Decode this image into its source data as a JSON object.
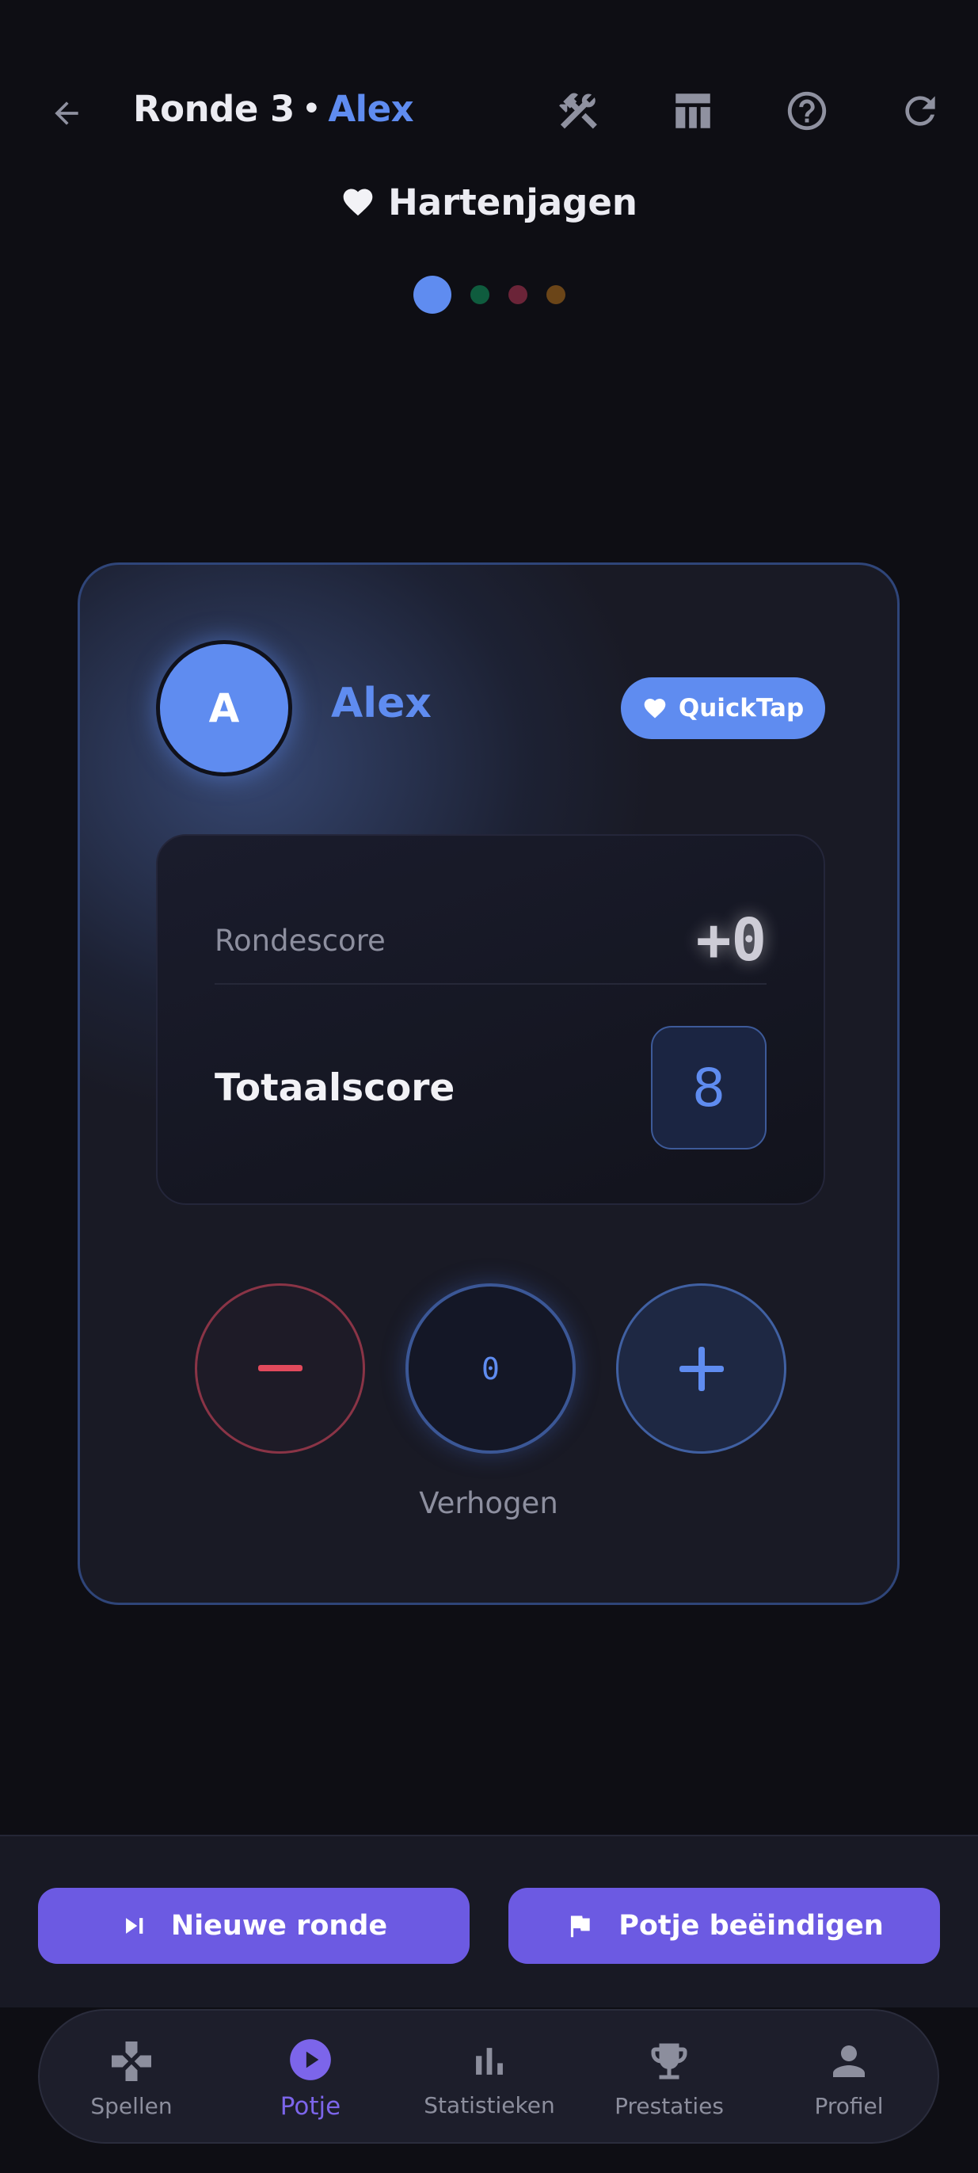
{
  "header": {
    "round_label": "Ronde 3",
    "separator": "•",
    "current_player": "Alex",
    "icons": [
      "back-arrow-icon",
      "tools-icon",
      "table-icon",
      "help-icon",
      "refresh-icon"
    ]
  },
  "game": {
    "title": "Hartenjagen",
    "icon": "heart-icon"
  },
  "pager": {
    "active_index": 0,
    "dot_colors": [
      "#5f8cf0",
      "#0f5c3e",
      "#6b2438",
      "#6b4518"
    ]
  },
  "player_card": {
    "avatar_initial": "A",
    "name": "Alex",
    "quicktap_label": "QuickTap",
    "round_score_label": "Rondescore",
    "round_score_value": "+0",
    "total_score_label": "Totaalscore",
    "total_score_value": "8",
    "stepper_value": "0",
    "stepper_mode_label": "Verhogen"
  },
  "actions": {
    "new_round_label": "Nieuwe ronde",
    "end_game_label": "Potje beëindigen"
  },
  "bottom_nav": {
    "items": [
      {
        "label": "Spellen",
        "icon": "gamepad-icon"
      },
      {
        "label": "Potje",
        "icon": "play-circle-icon"
      },
      {
        "label": "Statistieken",
        "icon": "bar-chart-icon"
      },
      {
        "label": "Prestaties",
        "icon": "trophy-icon"
      },
      {
        "label": "Profiel",
        "icon": "person-icon"
      }
    ],
    "active_index": 1
  },
  "colors": {
    "background": "#0e0e14",
    "accent_blue": "#5f8cf0",
    "accent_purple": "#6c5ae2",
    "minus_red": "#e24a5c"
  }
}
